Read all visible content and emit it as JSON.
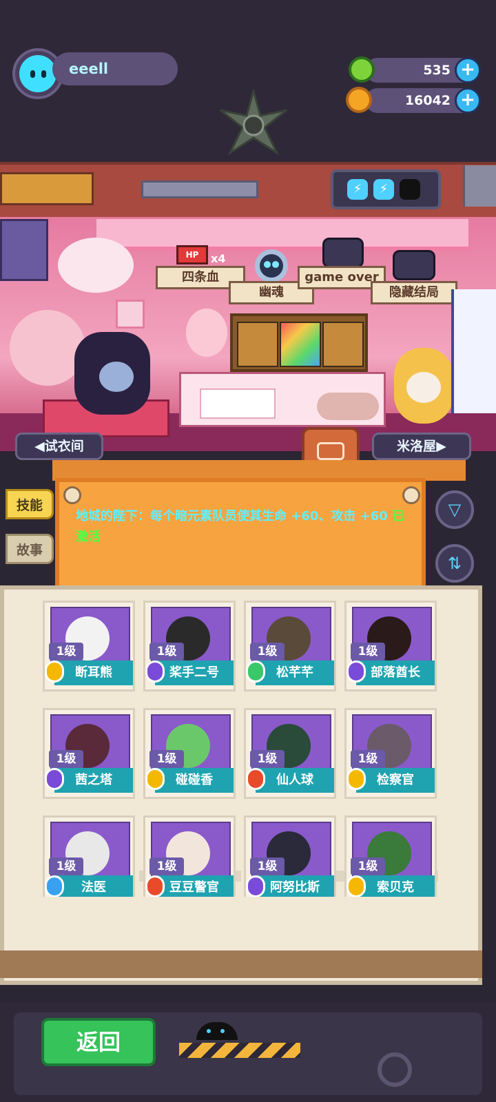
{
  "player": {
    "name": "eeell",
    "avatar_color": "#3fe0ff"
  },
  "resources": [
    {
      "icon": "green-donut-icon",
      "value": "535",
      "color": "#7ed23a"
    },
    {
      "icon": "gold-coin-planet-icon",
      "value": "16042",
      "color": "#f5a524"
    }
  ],
  "achievements": [
    {
      "label": "四条血",
      "icon_text": "HP",
      "badge": "x4",
      "icon": "hp-battery-icon"
    },
    {
      "label": "幽魂",
      "icon": "ghost-skull-icon"
    },
    {
      "label": "game over",
      "icon": "tombstone-tv-icon"
    },
    {
      "label": "隐藏结局",
      "icon": "hidden-ending-tv-icon"
    }
  ],
  "room_nav": {
    "left": "试衣间",
    "right": "米洛屋"
  },
  "side_tabs": {
    "skill": "技能",
    "story": "故事"
  },
  "board": {
    "text": "地城的陛下：每个暗元素队员使其生命 +60、攻击 +60",
    "status": "已激活"
  },
  "characters": [
    {
      "level": "1级",
      "name": "断耳熊",
      "badge_color": "#f5b800",
      "bg": "#8a5acb",
      "head": "#f2f2f2"
    },
    {
      "level": "1级",
      "name": "桨手二号",
      "badge_color": "#7a4ad8",
      "bg": "#8a5acb",
      "head": "#2a2a2a"
    },
    {
      "level": "1级",
      "name": "松芊芊",
      "badge_color": "#3ac86a",
      "bg": "#8a5acb",
      "head": "#5a4a3a"
    },
    {
      "level": "1级",
      "name": "部落酋长",
      "badge_color": "#7a4ad8",
      "bg": "#8a5acb",
      "head": "#2a1a1a"
    },
    {
      "level": "1级",
      "name": "茜之塔",
      "badge_color": "#7a4ad8",
      "bg": "#8a5acb",
      "head": "#5a2a3a"
    },
    {
      "level": "1级",
      "name": "碰碰香",
      "badge_color": "#f5b800",
      "bg": "#8a5acb",
      "head": "#6ac86a"
    },
    {
      "level": "1级",
      "name": "仙人球",
      "badge_color": "#e84a2a",
      "bg": "#8a5acb",
      "head": "#2a4a3a"
    },
    {
      "level": "1级",
      "name": "检察官",
      "badge_color": "#f5b800",
      "bg": "#8a5acb",
      "head": "#6a5a6a"
    },
    {
      "level": "1级",
      "name": "法医",
      "badge_color": "#3aa0f0",
      "bg": "#8a5acb",
      "head": "#e8e8e8"
    },
    {
      "level": "1级",
      "name": "豆豆警官",
      "badge_color": "#e84a2a",
      "bg": "#8a5acb",
      "head": "#f2e6dc"
    },
    {
      "level": "1级",
      "name": "阿努比斯",
      "badge_color": "#7a4ad8",
      "bg": "#8a5acb",
      "head": "#2a2a3a"
    },
    {
      "level": "1级",
      "name": "索贝克",
      "badge_color": "#f5b800",
      "bg": "#8a5acb",
      "head": "#3a7a3a"
    }
  ],
  "footer": {
    "back_label": "返回"
  },
  "colors": {
    "accent": "#1fa3b0",
    "board_text": "#5ef0ff",
    "active": "#4dff46"
  }
}
